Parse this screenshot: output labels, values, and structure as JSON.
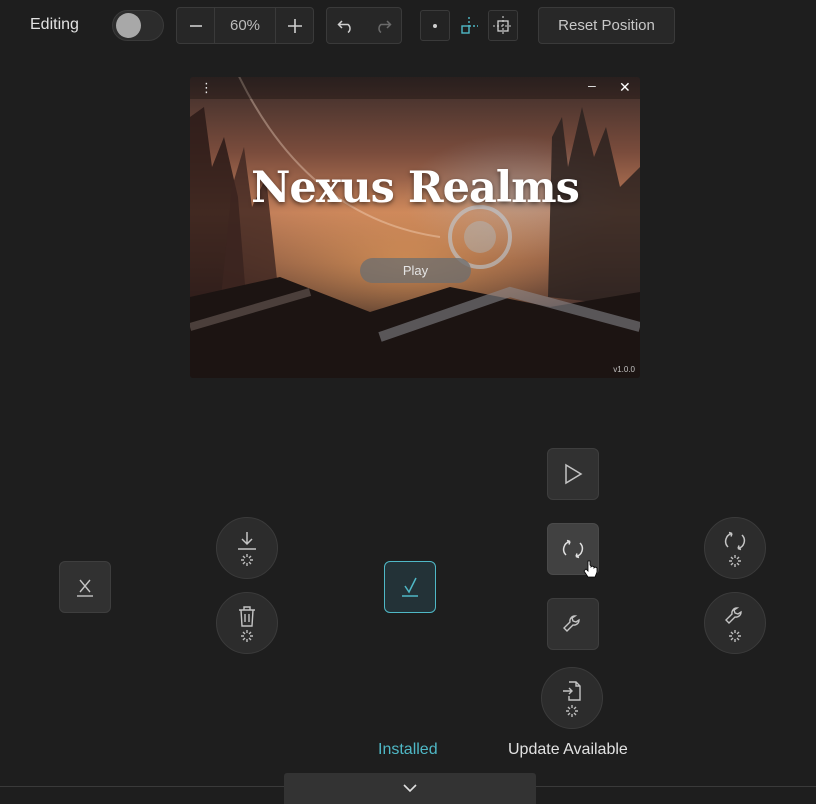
{
  "toolbar": {
    "editing_label": "Editing",
    "zoom_value": "60%",
    "reset_label": "Reset Position"
  },
  "preview": {
    "game_title": "Nexus Realms",
    "play_label": "Play",
    "version": "v1.0.0"
  },
  "status": {
    "installed_label": "Installed",
    "update_label": "Update Available"
  },
  "colors": {
    "accent": "#4fb8c6",
    "background": "#1e1e1e"
  },
  "icons": [
    "more-vertical-icon",
    "minimize-icon",
    "close-icon",
    "play-icon",
    "refresh-icon",
    "wrench-icon",
    "download-icon",
    "trash-icon",
    "file-import-icon",
    "check-icon",
    "x-icon",
    "chevron-down-icon"
  ]
}
